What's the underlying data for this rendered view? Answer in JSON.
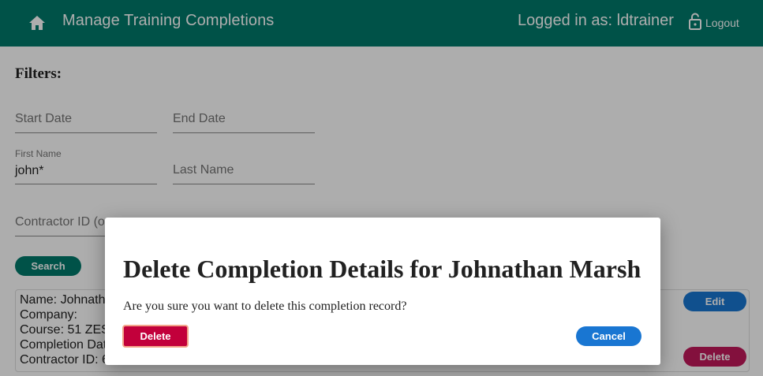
{
  "header": {
    "title": "Manage Training Completions",
    "login_status": "Logged in as: ldtrainer",
    "logout_label": "Logout",
    "home_icon": "home-icon",
    "lock_icon": "lock-open-icon"
  },
  "filters": {
    "heading": "Filters:",
    "start_date_label": "Start Date",
    "end_date_label": "End Date",
    "first_name_label": "First Name",
    "first_name_value": "john*",
    "last_name_label": "Last Name",
    "contractor_label": "Contractor ID (o",
    "search_label": "Search"
  },
  "result": {
    "lines": [
      "Name: Johnath",
      "Company:",
      "Course: 51 ZES",
      "Completion Dat",
      "Contractor ID: 6"
    ],
    "edit_label": "Edit",
    "delete_label": "Delete"
  },
  "dialog": {
    "title": "Delete Completion Details for Johnathan Marsh",
    "message": "Are you sure you want to delete this completion record?",
    "delete_label": "Delete",
    "cancel_label": "Cancel"
  },
  "colors": {
    "header": "#00796b",
    "primary": "#1976d2",
    "danger": "#c2185b",
    "dialog_delete": "#c2003b"
  }
}
